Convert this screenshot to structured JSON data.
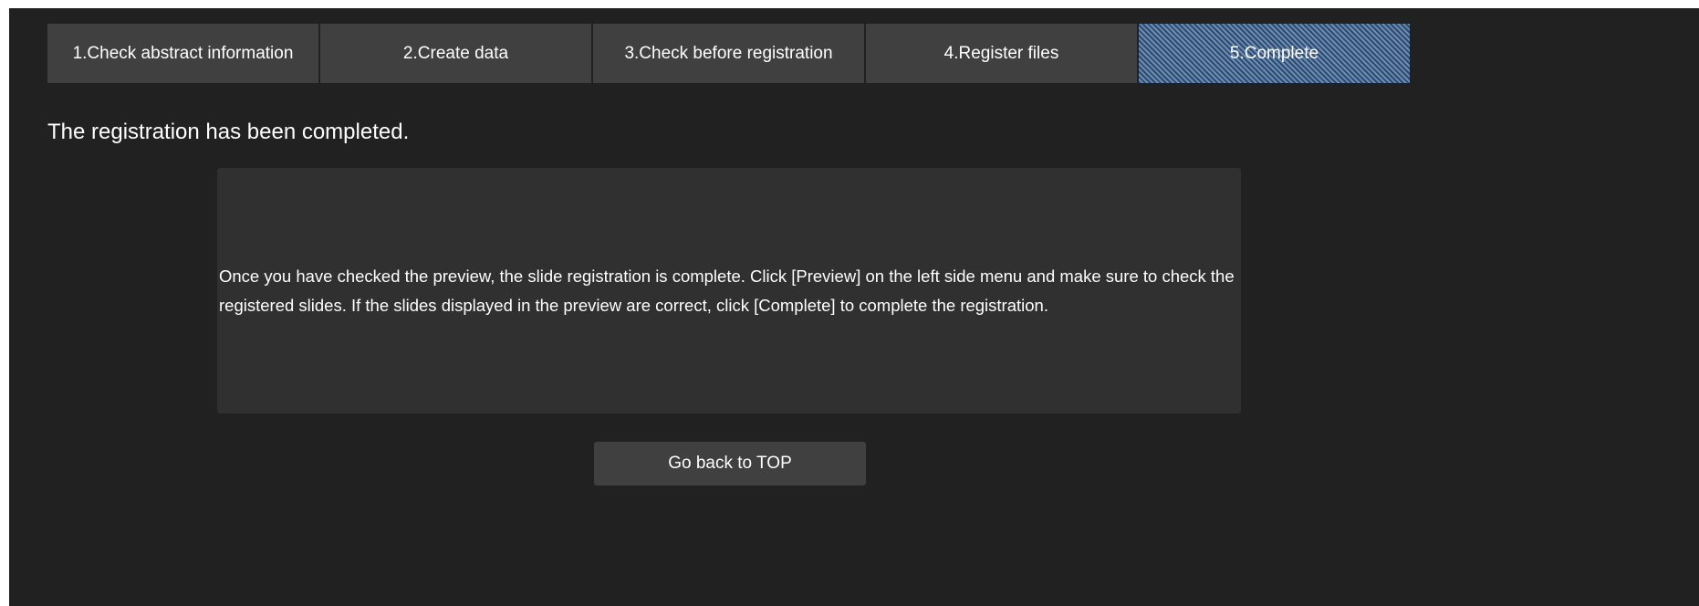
{
  "steps": [
    {
      "label": "1.Check abstract information",
      "active": false
    },
    {
      "label": "2.Create data",
      "active": false
    },
    {
      "label": "3.Check before registration",
      "active": false
    },
    {
      "label": "4.Register files",
      "active": false
    },
    {
      "label": "5.Complete",
      "active": true
    }
  ],
  "title": "The registration has been completed.",
  "message": "Once you have checked the preview, the slide registration is complete. Click [Preview] on the left side menu and make sure to check the registered slides. If the slides displayed in the preview are correct, click [Complete] to complete the registration.",
  "back_button_label": "Go back to TOP",
  "colors": {
    "background": "#212121",
    "step": "#404040",
    "active_step": "#3b5a82",
    "message_box": "#303030",
    "text": "#ffffff"
  }
}
